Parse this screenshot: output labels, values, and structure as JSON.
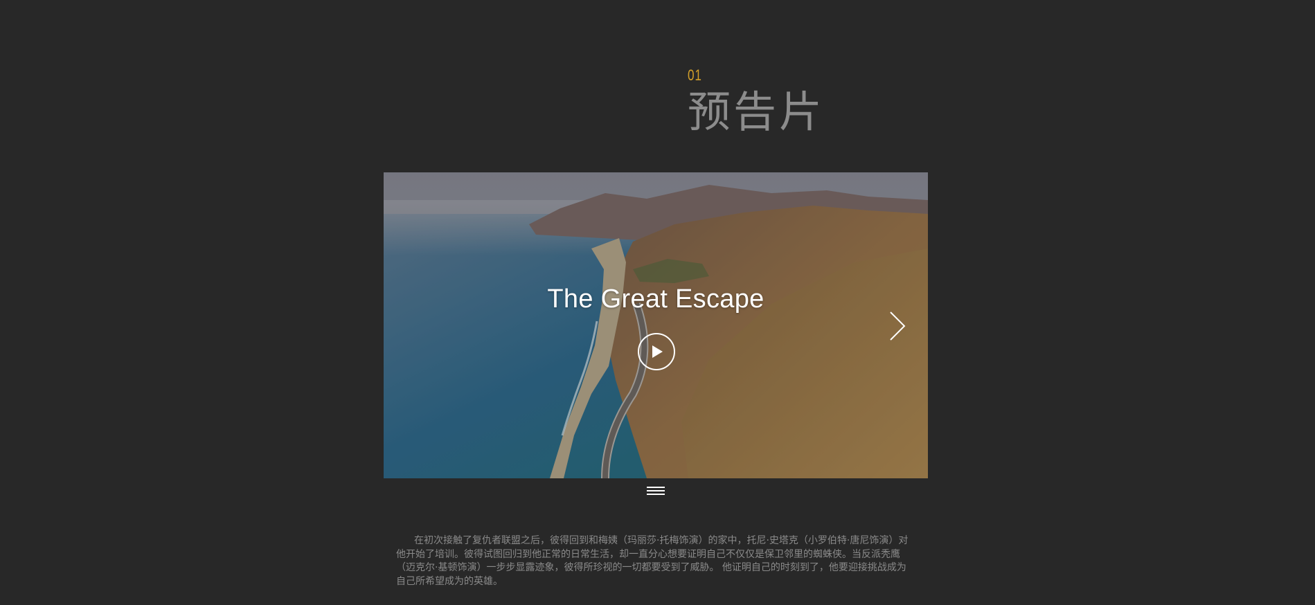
{
  "section": {
    "number": "01",
    "title": "预告片"
  },
  "video": {
    "title": "The Great Escape",
    "play_icon": "play-icon",
    "next_icon": "chevron-right-icon"
  },
  "menu": {
    "icon": "hamburger-menu-icon"
  },
  "description": {
    "text": "在初次接触了复仇者联盟之后，彼得回到和梅姨（玛丽莎·托梅饰演）的家中，托尼·史塔克（小罗伯特·唐尼饰演）对他开始了培训。彼得试图回归到他正常的日常生活，却一直分心想要证明自己不仅仅是保卫邻里的蜘蛛侠。当反派秃鹰（迈克尔·基顿饰演）一步步显露迹象，彼得所珍视的一切都要受到了威胁。 他证明自己的时刻到了，他要迎接挑战成为自己所希望成为的英雄。"
  },
  "colors": {
    "background": "#282828",
    "accent": "#d4a02a",
    "title": "#8c8c8c",
    "body_text": "#8a8a8a"
  }
}
